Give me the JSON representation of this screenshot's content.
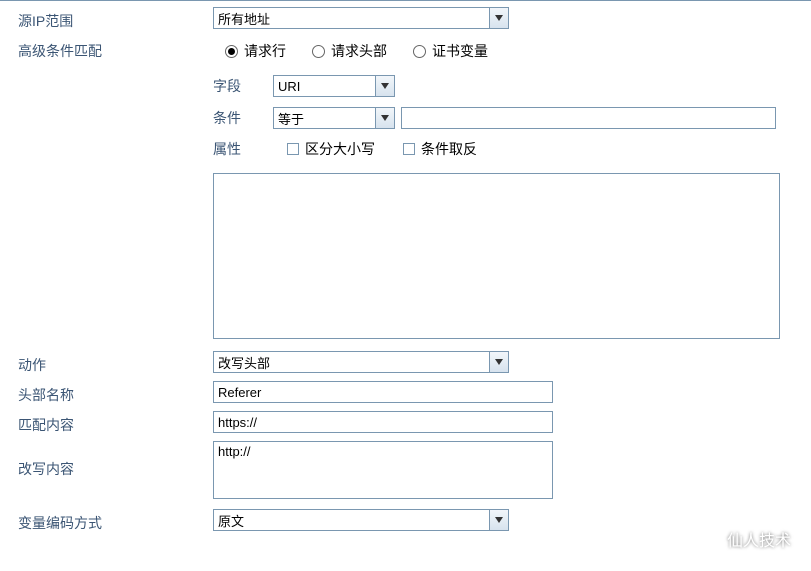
{
  "labels": {
    "sourceIpRange": "源IP范围",
    "advancedCondition": "高级条件匹配",
    "action": "动作",
    "headerName": "头部名称",
    "matchContent": "匹配内容",
    "rewriteContent": "改写内容",
    "encodingMethod": "变量编码方式"
  },
  "sourceIpRange": {
    "selected": "所有地址"
  },
  "matchType": {
    "options": {
      "requestLine": "请求行",
      "requestHeader": "请求头部",
      "certVariable": "证书变量"
    },
    "selected": "requestLine"
  },
  "sub": {
    "fieldLabel": "字段",
    "conditionLabel": "条件",
    "attributeLabel": "属性",
    "field": {
      "selected": "URI"
    },
    "condition": {
      "selected": "等于"
    },
    "conditionValue": "",
    "attrCaseSensitive": {
      "label": "区分大小写",
      "checked": false
    },
    "attrNegate": {
      "label": "条件取反",
      "checked": false
    }
  },
  "rulesText": "",
  "action": {
    "selected": "改写头部"
  },
  "headerName": "Referer",
  "matchContent": "https://",
  "rewriteContent": "http://",
  "encoding": {
    "selected": "原文"
  },
  "watermark": "仙人技术"
}
